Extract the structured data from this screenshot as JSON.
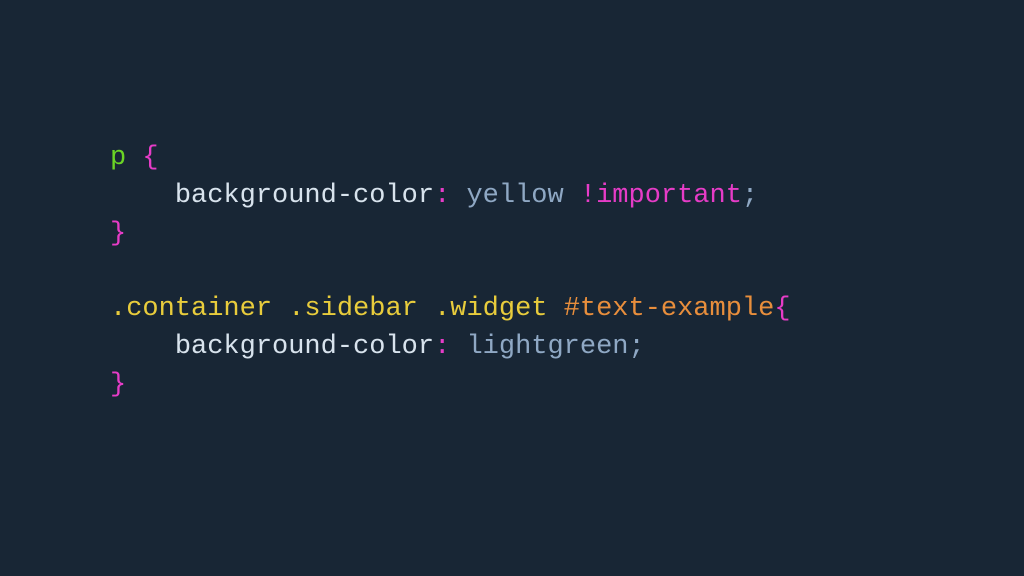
{
  "code": {
    "rule1": {
      "selector": "p",
      "property": "background-color",
      "value": "yellow",
      "important": "!important"
    },
    "rule2": {
      "selector1": ".container",
      "selector2": ".sidebar",
      "selector3": ".widget",
      "selector4": "#text-example",
      "property": "background-color",
      "value": "lightgreen"
    }
  },
  "syntax": {
    "openBrace": "{",
    "closeBrace": "}",
    "colon": ":",
    "semicolon": ";",
    "indent": "    "
  }
}
